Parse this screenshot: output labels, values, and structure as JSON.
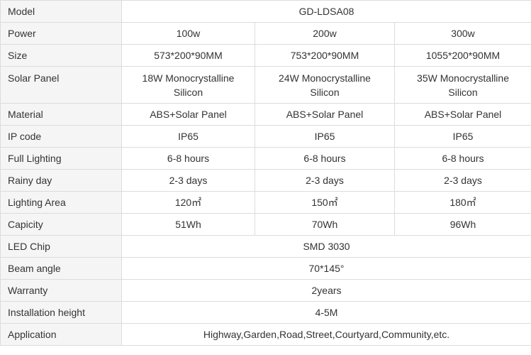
{
  "table": {
    "model": {
      "label": "Model",
      "value": "GD-LDSA08"
    },
    "power": {
      "label": "Power",
      "values": [
        "100w",
        "200w",
        "300w"
      ]
    },
    "size": {
      "label": "Size",
      "values": [
        "573*200*90MM",
        "753*200*90MM",
        "1055*200*90MM"
      ]
    },
    "solar_panel": {
      "label": "Solar Panel",
      "values": [
        {
          "line1": "18W Monocrystalline",
          "line2": "Silicon"
        },
        {
          "line1": "24W Monocrystalline",
          "line2": "Silicon"
        },
        {
          "line1": "35W Monocrystalline",
          "line2": "Silicon"
        }
      ]
    },
    "material": {
      "label": "Material",
      "values": [
        "ABS+Solar Panel",
        "ABS+Solar Panel",
        "ABS+Solar Panel"
      ]
    },
    "ip_code": {
      "label": "IP code",
      "values": [
        "IP65",
        "IP65",
        "IP65"
      ]
    },
    "full_lighting": {
      "label": "Full Lighting",
      "values": [
        "6-8 hours",
        "6-8 hours",
        "6-8 hours"
      ]
    },
    "rainy_day": {
      "label": "Rainy day",
      "values": [
        "2-3 days",
        "2-3 days",
        "2-3 days"
      ]
    },
    "lighting_area": {
      "label": "Lighting Area",
      "values": [
        "120㎡",
        "150㎡",
        "180㎡"
      ]
    },
    "capicity": {
      "label": "Capicity",
      "values": [
        "51Wh",
        "70Wh",
        "96Wh"
      ]
    },
    "led_chip": {
      "label": "LED Chip",
      "value": "SMD 3030"
    },
    "beam_angle": {
      "label": "Beam angle",
      "value": "70*145°"
    },
    "warranty": {
      "label": "Warranty",
      "value": "2years"
    },
    "installation_height": {
      "label": "Installation height",
      "value": "4-5M"
    },
    "application": {
      "label": "Application",
      "value": "Highway,Garden,Road,Street,Courtyard,Community,etc."
    }
  }
}
